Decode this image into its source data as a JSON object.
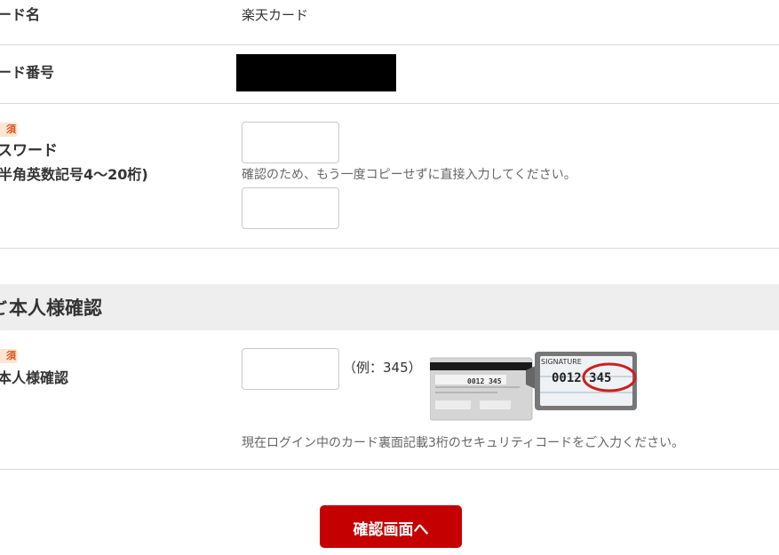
{
  "card_name": {
    "label": "ード名",
    "value": "楽天カード"
  },
  "card_number": {
    "label": "ード番号"
  },
  "password": {
    "badge": "須",
    "label_line1": "スワード",
    "label_line2": "半角英数記号4〜20桁)",
    "confirm_hint": "確認のため、もう一度コピーせずに直接入力してください。"
  },
  "identity_section": {
    "title": "本人様確認"
  },
  "identity": {
    "badge": "須",
    "label": "本人様確認",
    "example": "（例：345）",
    "card_image": {
      "signature_text": "SIGNATURE",
      "code_text": "0012 345",
      "highlight_text": "345"
    },
    "hint": "現在ログイン中のカード裏面記載3桁のセキュリティコードをご入力ください。"
  },
  "confirm_button": {
    "label": "確認画面へ"
  },
  "colors": {
    "accent_red": "#c40000",
    "badge_bg": "#fde5d3",
    "section_bg": "#eeeeee"
  }
}
